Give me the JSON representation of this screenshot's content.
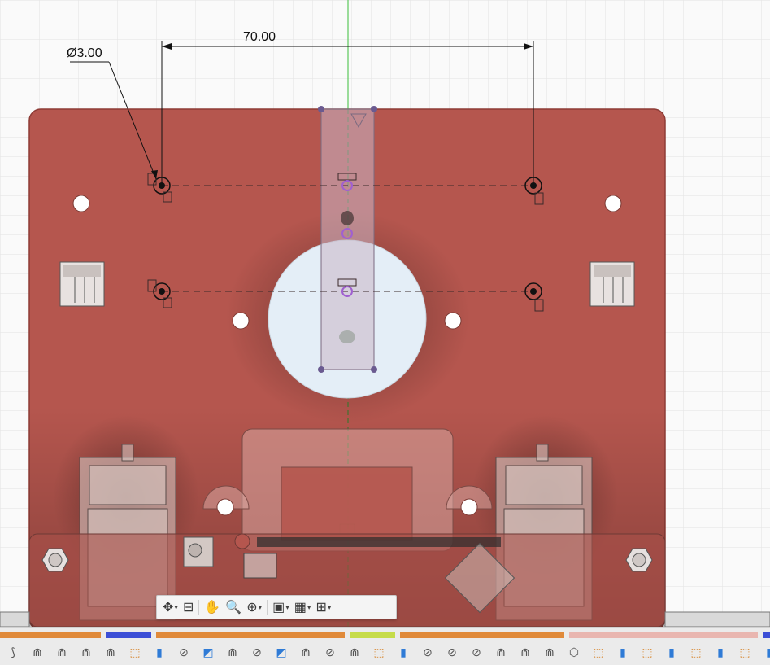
{
  "dimensions": {
    "diameter_label": "Ø3.00",
    "length_label": "70.00"
  },
  "colors": {
    "board": "#b5564e",
    "board_edge": "#8e3c36",
    "grid": "#dcdcdc",
    "axis_green": "#3bbf3b",
    "constraint_purple": "#a060d0"
  },
  "nav_toolbar": [
    {
      "name": "orbit-icon",
      "glyph": "✥",
      "caret": "▾"
    },
    {
      "name": "look-at-icon",
      "glyph": "⊟",
      "caret": ""
    },
    {
      "name": "pan-hand-icon",
      "glyph": "✋",
      "caret": ""
    },
    {
      "name": "zoom-icon",
      "glyph": "🔍",
      "caret": ""
    },
    {
      "name": "zoom-window-icon",
      "glyph": "⊕",
      "caret": "▾"
    },
    {
      "name": "display-settings-icon",
      "glyph": "▣",
      "caret": "▾"
    },
    {
      "name": "grid-settings-icon",
      "glyph": "▦",
      "caret": "▾"
    },
    {
      "name": "viewports-icon",
      "glyph": "⊞",
      "caret": "▾"
    }
  ],
  "timeline_groups": [
    {
      "color": "#e08a3a",
      "start": 0,
      "width": 124
    },
    {
      "color": "#3c4fd6",
      "start": 130,
      "width": 56
    },
    {
      "color": "#e08a3a",
      "start": 192,
      "width": 232
    },
    {
      "color": "#c6dc4a",
      "start": 430,
      "width": 56
    },
    {
      "color": "#e08a3a",
      "start": 492,
      "width": 202
    },
    {
      "color": "#e9b6b0",
      "start": 700,
      "width": 232
    },
    {
      "color": "#3c4fd6",
      "start": 938,
      "width": 9
    }
  ],
  "timeline_features": [
    {
      "name": "sketch-icon",
      "glyph": "⟆",
      "tone": "grey"
    },
    {
      "name": "feature-icon",
      "glyph": "⋒",
      "tone": "grey"
    },
    {
      "name": "feature-icon",
      "glyph": "⋒",
      "tone": "grey"
    },
    {
      "name": "feature-icon",
      "glyph": "⋒",
      "tone": "grey"
    },
    {
      "name": "feature-icon",
      "glyph": "⋒",
      "tone": "grey"
    },
    {
      "name": "sketch-icon",
      "glyph": "⬚",
      "tone": "orange"
    },
    {
      "name": "extrude-icon",
      "glyph": "▮",
      "tone": "blue"
    },
    {
      "name": "joint-icon",
      "glyph": "⊘",
      "tone": "grey"
    },
    {
      "name": "component-icon",
      "glyph": "◩",
      "tone": "blue"
    },
    {
      "name": "feature-icon",
      "glyph": "⋒",
      "tone": "grey"
    },
    {
      "name": "joint-icon",
      "glyph": "⊘",
      "tone": "grey"
    },
    {
      "name": "component-icon",
      "glyph": "◩",
      "tone": "blue"
    },
    {
      "name": "feature-icon",
      "glyph": "⋒",
      "tone": "grey"
    },
    {
      "name": "joint-icon",
      "glyph": "⊘",
      "tone": "grey"
    },
    {
      "name": "feature-icon",
      "glyph": "⋒",
      "tone": "grey"
    },
    {
      "name": "sketch-icon",
      "glyph": "⬚",
      "tone": "orange"
    },
    {
      "name": "extrude-icon",
      "glyph": "▮",
      "tone": "blue"
    },
    {
      "name": "joint-icon",
      "glyph": "⊘",
      "tone": "grey"
    },
    {
      "name": "joint-icon",
      "glyph": "⊘",
      "tone": "grey"
    },
    {
      "name": "joint-icon",
      "glyph": "⊘",
      "tone": "grey"
    },
    {
      "name": "feature-icon",
      "glyph": "⋒",
      "tone": "grey"
    },
    {
      "name": "feature-icon",
      "glyph": "⋒",
      "tone": "grey"
    },
    {
      "name": "feature-icon",
      "glyph": "⋒",
      "tone": "grey"
    },
    {
      "name": "box-icon",
      "glyph": "⬡",
      "tone": "grey"
    },
    {
      "name": "sketch-icon",
      "glyph": "⬚",
      "tone": "orange"
    },
    {
      "name": "extrude-icon",
      "glyph": "▮",
      "tone": "blue"
    },
    {
      "name": "sketch-icon",
      "glyph": "⬚",
      "tone": "orange"
    },
    {
      "name": "extrude-icon",
      "glyph": "▮",
      "tone": "blue"
    },
    {
      "name": "sketch-icon",
      "glyph": "⬚",
      "tone": "orange"
    },
    {
      "name": "extrude-icon",
      "glyph": "▮",
      "tone": "blue"
    },
    {
      "name": "sketch-icon",
      "glyph": "⬚",
      "tone": "orange"
    },
    {
      "name": "extrude-icon",
      "glyph": "▮",
      "tone": "blue"
    }
  ]
}
